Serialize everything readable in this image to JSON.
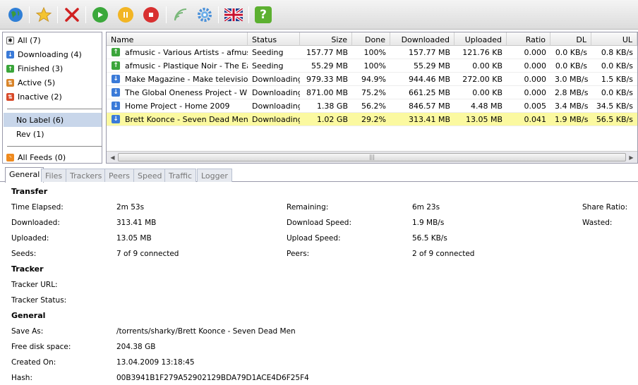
{
  "toolbar": {
    "icons": [
      "globe-icon",
      "star-icon",
      "remove-icon",
      "play-icon",
      "pause-icon",
      "stop-icon",
      "signal-icon",
      "gear-icon",
      "uk-flag-icon",
      "help-icon"
    ]
  },
  "sidebar": {
    "states": [
      {
        "label": "All (7)",
        "icon": "all-icon"
      },
      {
        "label": "Downloading (4)",
        "icon": "downloading-icon"
      },
      {
        "label": "Finished (3)",
        "icon": "finished-icon"
      },
      {
        "label": "Active (5)",
        "icon": "active-icon"
      },
      {
        "label": "Inactive (2)",
        "icon": "inactive-icon"
      }
    ],
    "labels": [
      {
        "label": "No Label (6)"
      },
      {
        "label": "Rev (1)"
      }
    ],
    "feeds": [
      {
        "label": "All Feeds (0)",
        "icon": "rss-icon"
      }
    ]
  },
  "torrents": {
    "columns": [
      "Name",
      "Status",
      "Size",
      "Done",
      "Downloaded",
      "Uploaded",
      "Ratio",
      "DL",
      "UL"
    ],
    "rows": [
      {
        "name": "afmusic - Various Artists - afmusic _",
        "status": "Seeding",
        "size": "157.77 MB",
        "done": "100%",
        "downloaded": "157.77 MB",
        "uploaded": "121.76 KB",
        "ratio": "0.000",
        "dl": "0.0 KB/s",
        "ul": "0.8 KB/s",
        "type": "up"
      },
      {
        "name": "afmusic - Plastique Noir - The Early",
        "status": "Seeding",
        "size": "55.29 MB",
        "done": "100%",
        "downloaded": "55.29 MB",
        "uploaded": "0.00 KB",
        "ratio": "0.000",
        "dl": "0.0 KB/s",
        "ul": "0.0 KB/s",
        "type": "up"
      },
      {
        "name": "Make Magazine - Make television Ep",
        "status": "Downloading",
        "size": "979.33 MB",
        "done": "94.9%",
        "downloaded": "944.46 MB",
        "uploaded": "272.00 KB",
        "ratio": "0.000",
        "dl": "3.0 MB/s",
        "ul": "1.5 KB/s",
        "type": "dn"
      },
      {
        "name": "The Global Oneness Project - What",
        "status": "Downloading",
        "size": "871.00 MB",
        "done": "75.2%",
        "downloaded": "661.25 MB",
        "uploaded": "0.00 KB",
        "ratio": "0.000",
        "dl": "2.8 MB/s",
        "ul": "0.0 KB/s",
        "type": "dn"
      },
      {
        "name": "Home Project - Home 2009",
        "status": "Downloading",
        "size": "1.38 GB",
        "done": "56.2%",
        "downloaded": "846.57 MB",
        "uploaded": "4.48 MB",
        "ratio": "0.005",
        "dl": "3.4 MB/s",
        "ul": "34.5 KB/s",
        "type": "dn"
      },
      {
        "name": "Brett Koonce - Seven Dead Men",
        "status": "Downloading",
        "size": "1.02 GB",
        "done": "29.2%",
        "downloaded": "313.41 MB",
        "uploaded": "13.05 MB",
        "ratio": "0.041",
        "dl": "1.9 MB/s",
        "ul": "56.5 KB/s",
        "type": "dn",
        "selected": true
      }
    ]
  },
  "tabs": [
    "General",
    "Files",
    "Trackers",
    "Peers",
    "Speed",
    "Traffic",
    "Logger"
  ],
  "details": {
    "transfer_title": "Transfer",
    "time_elapsed_label": "Time Elapsed:",
    "time_elapsed": "2m 53s",
    "downloaded_label": "Downloaded:",
    "downloaded": "313.41 MB",
    "uploaded_label": "Uploaded:",
    "uploaded": "13.05 MB",
    "seeds_label": "Seeds:",
    "seeds": "7 of 9 connected",
    "remaining_label": "Remaining:",
    "remaining": "6m 23s",
    "download_speed_label": "Download Speed:",
    "download_speed": "1.9 MB/s",
    "upload_speed_label": "Upload Speed:",
    "upload_speed": "56.5 KB/s",
    "peers_label": "Peers:",
    "peers": "2 of 9 connected",
    "share_ratio_label": "Share Ratio:",
    "wasted_label": "Wasted:",
    "tracker_title": "Tracker",
    "tracker_url_label": "Tracker URL:",
    "tracker_status_label": "Tracker Status:",
    "general_title": "General",
    "save_as_label": "Save As:",
    "save_as": "/torrents/sharky/Brett Koonce - Seven Dead Men",
    "free_disk_label": "Free disk space:",
    "free_disk": "204.38 GB",
    "created_on_label": "Created On:",
    "created_on": "13.04.2009 13:18:45",
    "hash_label": "Hash:",
    "hash": "00B3941B1F279A52902129BDA79D1ACE4D6F25F4"
  }
}
